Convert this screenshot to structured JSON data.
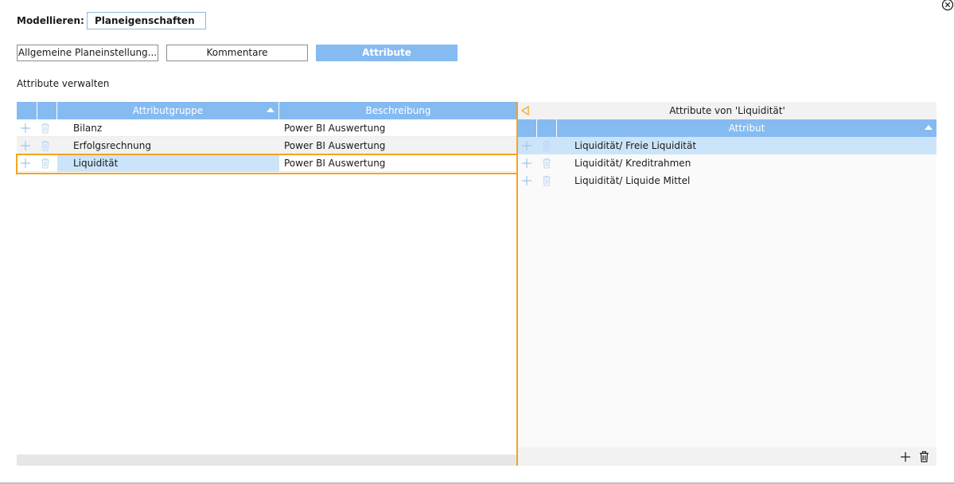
{
  "header": {
    "model_label": "Modellieren:",
    "model_value": "Planeigenschaften"
  },
  "tabs": [
    {
      "label": "Allgemeine Planeinstellung..."
    },
    {
      "label": "Kommentare"
    },
    {
      "label": "Attribute",
      "active": true
    }
  ],
  "section_title": "Attribute verwalten",
  "left_grid": {
    "columns": {
      "group": "Attributgruppe",
      "description": "Beschreibung"
    },
    "rows": [
      {
        "group": "Bilanz",
        "description": "Power BI Auswertung"
      },
      {
        "group": "Erfolgsrechnung",
        "description": "Power BI Auswertung"
      },
      {
        "group": "Liquidität",
        "description": "Power BI Auswertung",
        "selected": true
      }
    ]
  },
  "right_panel": {
    "title": "Attribute von 'Liquidität'",
    "column": "Attribut",
    "rows": [
      {
        "attribute": "Liquidität/ Freie Liquidität",
        "selected": true
      },
      {
        "attribute": "Liquidität/ Kreditrahmen"
      },
      {
        "attribute": "Liquidität/ Liquide Mittel"
      }
    ]
  },
  "colors": {
    "accent": "#86bbf1",
    "selection": "#cce4f9",
    "highlight_outline": "#f5a51d"
  },
  "icons": {
    "close": "close-circle-icon",
    "add": "plus-icon",
    "delete": "trash-icon",
    "sort": "sort-ascending-icon",
    "collapse": "collapse-left-icon"
  }
}
